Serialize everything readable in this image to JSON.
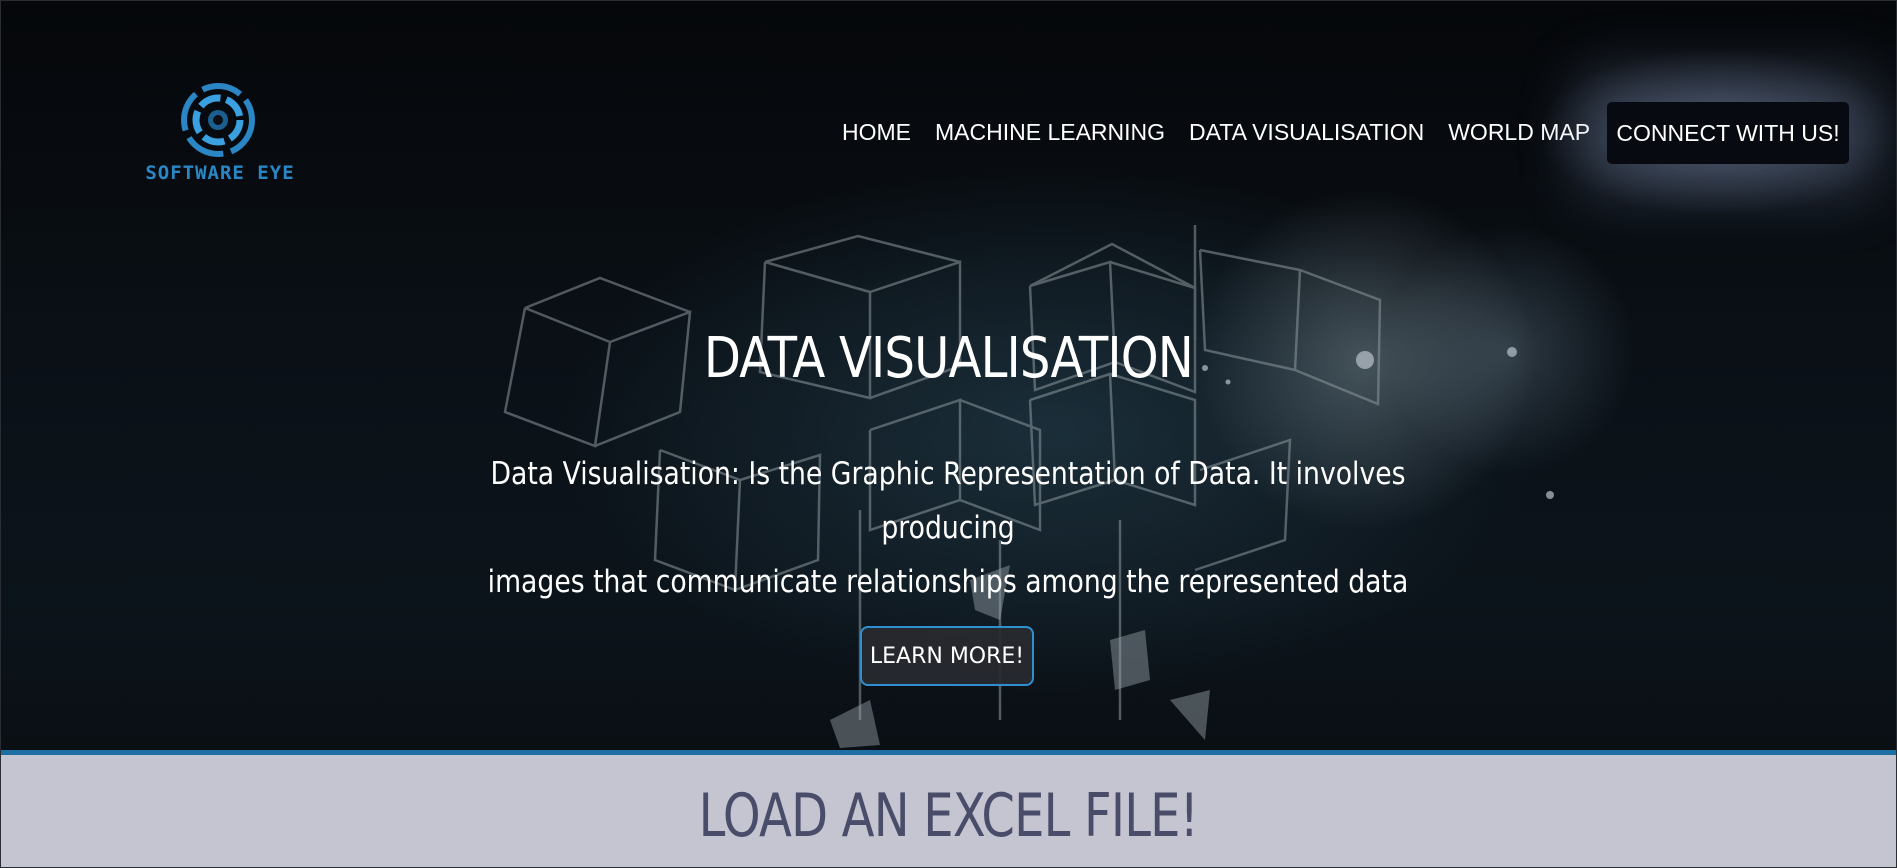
{
  "brand": {
    "logo_text": "SOFTWARE EYE",
    "logo_icon": "eye-lens-icon",
    "accent_color": "#2b86c5"
  },
  "nav": {
    "items": [
      {
        "label": "HOME"
      },
      {
        "label": "MACHINE LEARNING"
      },
      {
        "label": "DATA VISUALISATION"
      },
      {
        "label": "WORLD MAP"
      }
    ],
    "cta_label": "CONNECT WITH US!"
  },
  "hero": {
    "title": "DATA VISUALISATION",
    "subtitle_line1": "Data Visualisation: Is the Graphic Representation of Data. It involves producing",
    "subtitle_line2": "images that communicate relationships among the represented data",
    "button_label": "LEARN MORE!",
    "button_border_color": "#2f8fd0"
  },
  "section": {
    "title": "LOAD AN EXCEL FILE!",
    "divider_color": "#1d6fa3",
    "background_color": "#c4c5d0"
  }
}
